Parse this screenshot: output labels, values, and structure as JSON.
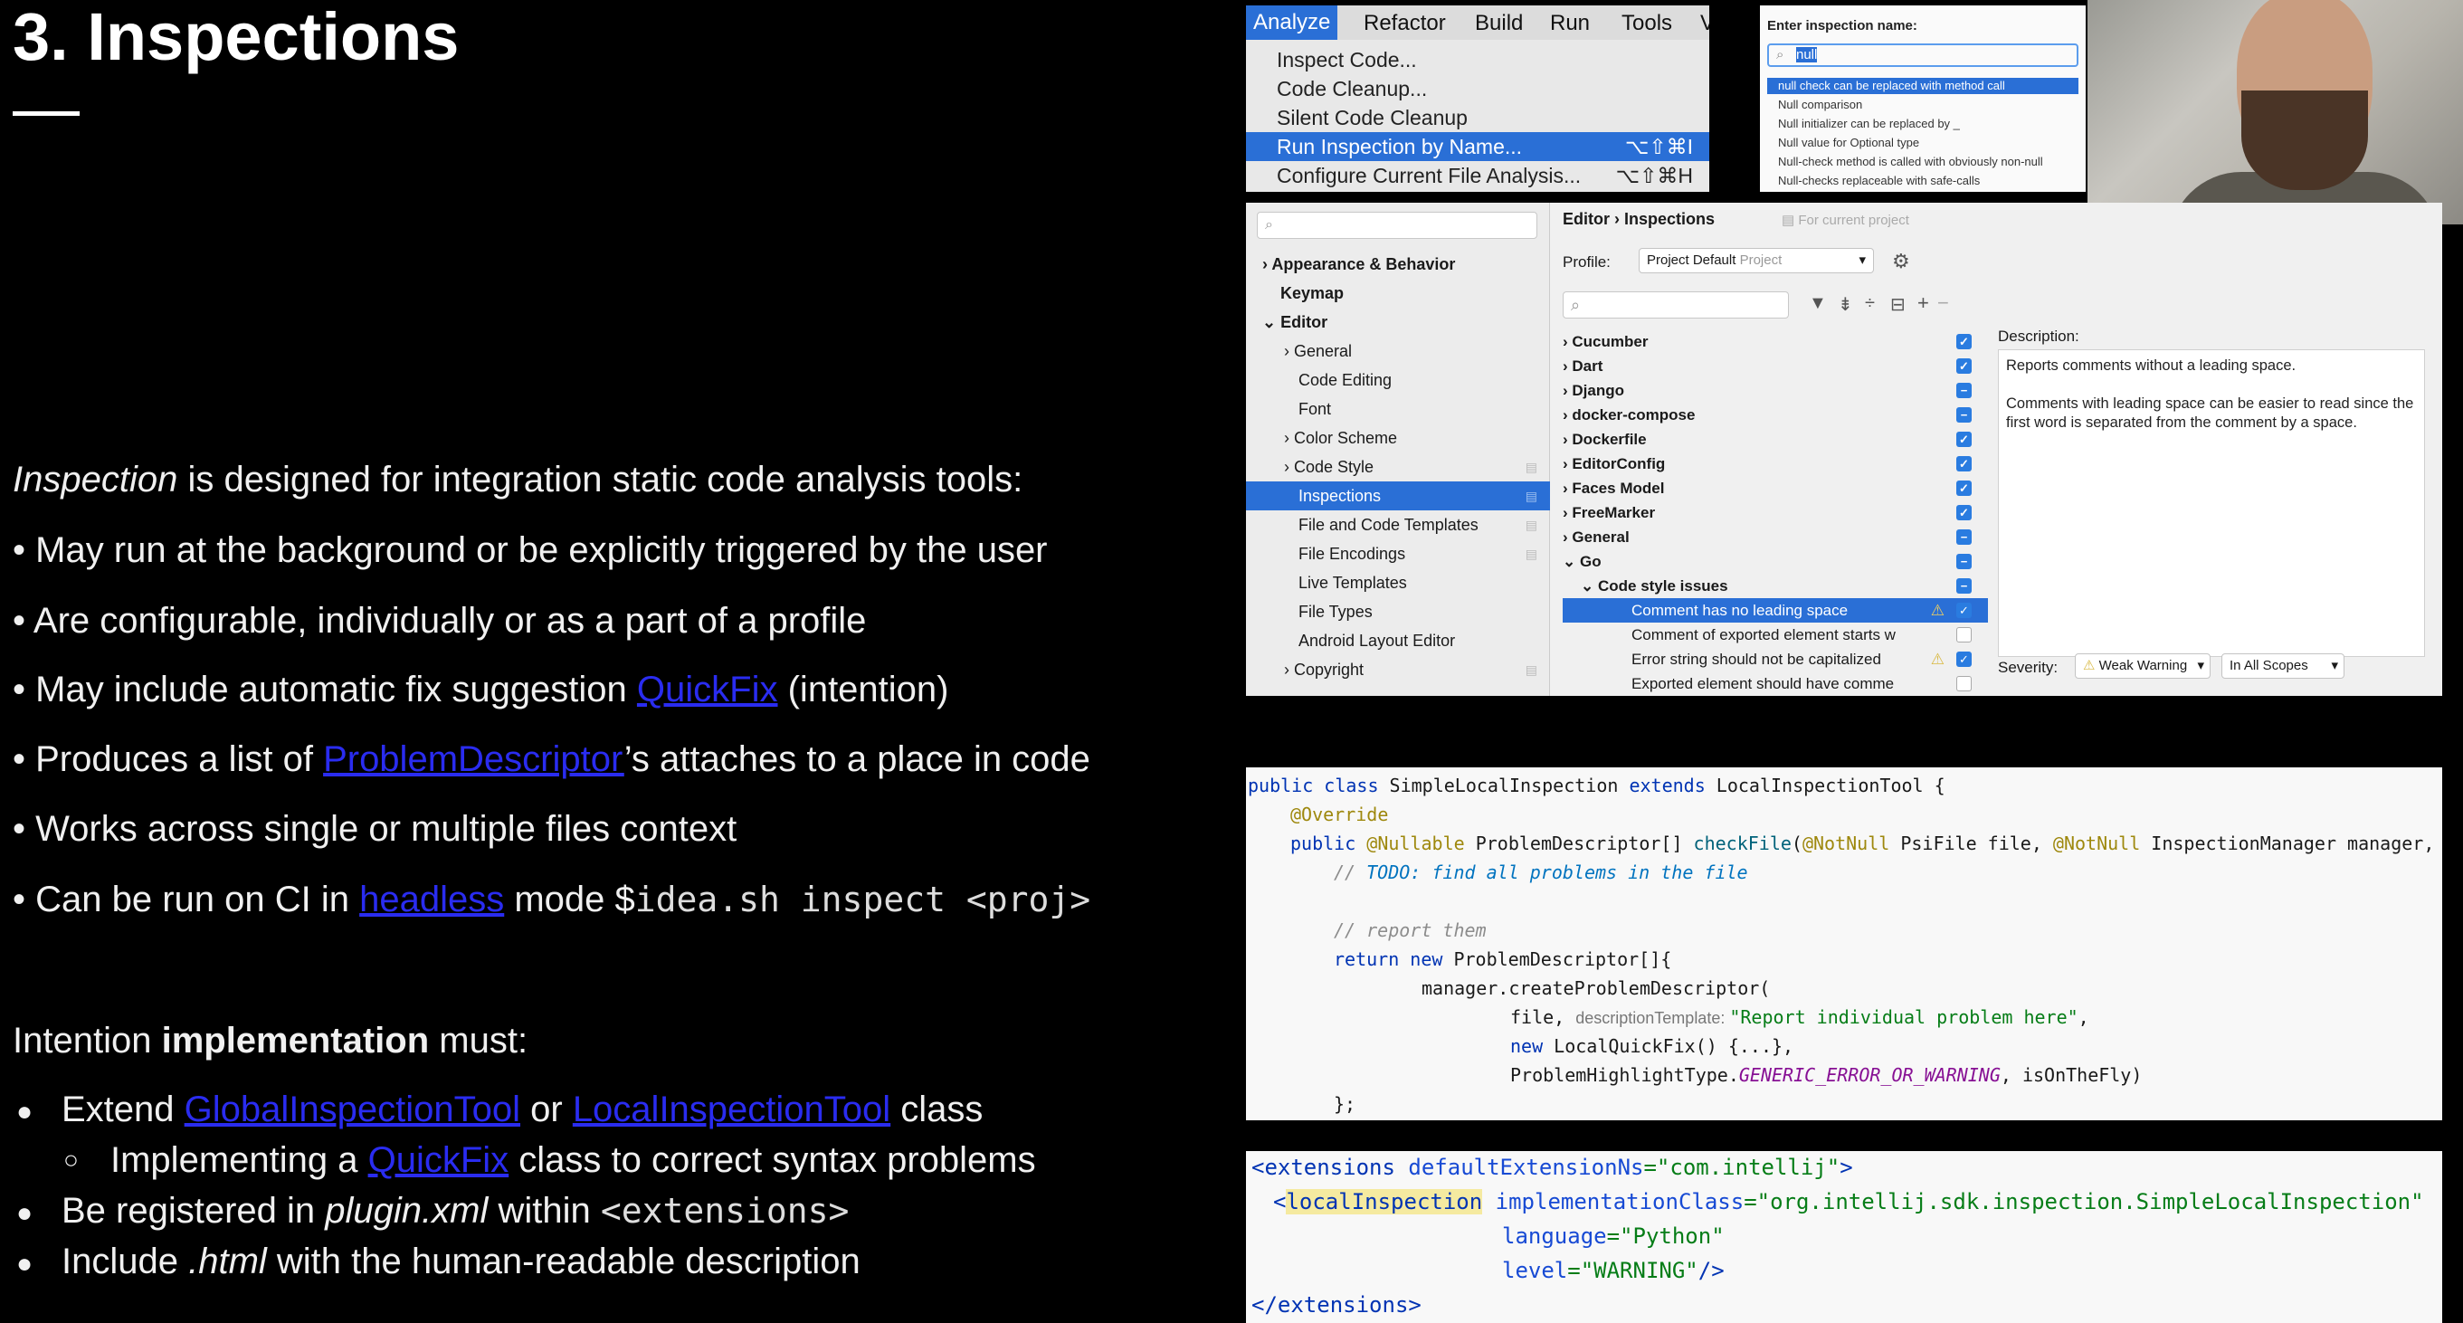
{
  "slide": {
    "title": "3. Inspections",
    "intro_em": "Inspection",
    "intro_rest": " is designed for integration static code analysis tools:",
    "bullets": [
      "May run at the background or be explicitly triggered by the user",
      "Are configurable, individually or as a part of a profile"
    ],
    "b3_pre": "May include automatic fix suggestion ",
    "b3_link": "QuickFix",
    "b3_post": " (intention)",
    "b4_pre": "Produces a list of ",
    "b4_link": "ProblemDescriptor",
    "b4_post": "’s attaches to a place in code",
    "b5": "Works across single or multiple files context",
    "b6_pre": "Can be run on CI in ",
    "b6_link": "headless",
    "b6_mid": " mode $",
    "b6_code": "idea.sh inspect <proj>",
    "impl_pre": "Intention ",
    "impl_bold": "implementation",
    "impl_post": " must:",
    "i1_pre": "Extend ",
    "i1_link1": "GlobalInspectionTool",
    "i1_mid": " or ",
    "i1_link2": "LocalInspectionTool",
    "i1_post": " class",
    "i2_pre": "Implementing a ",
    "i2_link": "QuickFix",
    "i2_post": " class to correct syntax problems",
    "i3_pre": "Be registered in ",
    "i3_em": "plugin.xml",
    "i3_mid": " within ",
    "i3_code": "<extensions>",
    "i4_pre": "Include ",
    "i4_em": ".html",
    "i4_post": " with the human-readable description"
  },
  "menu": {
    "bar": [
      "Analyze",
      "Refactor",
      "Build",
      "Run",
      "Tools",
      "VCS"
    ],
    "items": [
      {
        "label": "Inspect Code...",
        "shortcut": ""
      },
      {
        "label": "Code Cleanup...",
        "shortcut": ""
      },
      {
        "label": "Silent Code Cleanup",
        "shortcut": ""
      },
      {
        "label": "Run Inspection by Name...",
        "shortcut": "⌥⇧⌘I"
      },
      {
        "label": "Configure Current File Analysis...",
        "shortcut": "⌥⇧⌘H"
      }
    ]
  },
  "inspection_popup": {
    "header": "Enter inspection name:",
    "query": "null",
    "results": [
      "null check can be replaced with method call",
      "Null comparison",
      "Null initializer can be replaced by _",
      "Null value for Optional type",
      "Null-check method is called with obviously non-null",
      "Null-checks replaceable with safe-calls"
    ]
  },
  "settings": {
    "tree": [
      "Appearance & Behavior",
      "Keymap",
      "Editor",
      "General",
      "Code Editing",
      "Font",
      "Color Scheme",
      "Code Style",
      "Inspections",
      "File and Code Templates",
      "File Encodings",
      "Live Templates",
      "File Types",
      "Android Layout Editor",
      "Copyright"
    ],
    "breadcrumb_editor": "Editor",
    "breadcrumb_sep": "›",
    "breadcrumb_page": "Inspections",
    "scope_note": "For current project",
    "profile_label": "Profile:",
    "profile_value": "Project Default",
    "profile_kind": "Project",
    "inspections": [
      "Cucumber",
      "Dart",
      "Django",
      "docker-compose",
      "Dockerfile",
      "EditorConfig",
      "Faces Model",
      "FreeMarker",
      "General",
      "Go",
      "Code style issues",
      "Comment has no leading space",
      "Comment of exported element starts w",
      "Error string should not be capitalized",
      "Exported element should have comme"
    ],
    "description_label": "Description:",
    "description_p1": "Reports comments without a leading space.",
    "description_p2": "Comments with leading space can be easier to read since the first word is separated from the comment by a space.",
    "severity_label": "Severity:",
    "severity_value": "Weak Warning",
    "scope_value": "In All Scopes"
  },
  "code1": {
    "l1_kw": "public class ",
    "l1_name": "SimpleLocalInspection ",
    "l1_kw2": "extends ",
    "l1_rest": "LocalInspectionTool {",
    "l2": "@Override",
    "l3_kw": "public ",
    "l3_an": "@Nullable ",
    "l3_type": "ProblemDescriptor[] ",
    "l3_fn": "checkFile",
    "l3_p1": "(",
    "l3_an2": "@NotNull ",
    "l3_p2": "PsiFile file, ",
    "l3_an3": "@NotNull ",
    "l3_p3": "InspectionManager manager,",
    "l4_c": "// ",
    "l4_todo": "TODO: find all problems in the file",
    "l5": "// report them",
    "l6_kw": "return new ",
    "l6_rest": "ProblemDescriptor[]{",
    "l7": "manager.createProblemDescriptor(",
    "l8_a": "file, ",
    "l8_hint": "descriptionTemplate: ",
    "l8_str": "\"Report individual problem here\"",
    "l8_end": ",",
    "l9_kw": "new ",
    "l9_rest": "LocalQuickFix() {...},",
    "l10_a": "ProblemHighlightType.",
    "l10_c": "GENERIC_ERROR_OR_WARNING",
    "l10_b": ", isOnTheFly)",
    "l11": "};"
  },
  "code2": {
    "l1_tag": "<extensions ",
    "l1_attr": "defaultExtensionNs",
    "l1_val": "=\"com.intellij\"",
    "l1_end": ">",
    "l2_lt": "<",
    "l2_tag": "localInspection",
    "l2_attr": " implementationClass",
    "l2_val": "=\"org.intellij.sdk.inspection.SimpleLocalInspection\"",
    "l3_attr": "language",
    "l3_val": "=\"Python\"",
    "l4_attr": "level",
    "l4_val": "=\"WARNING\"",
    "l4_end": "/>",
    "l5": "</extensions>"
  }
}
